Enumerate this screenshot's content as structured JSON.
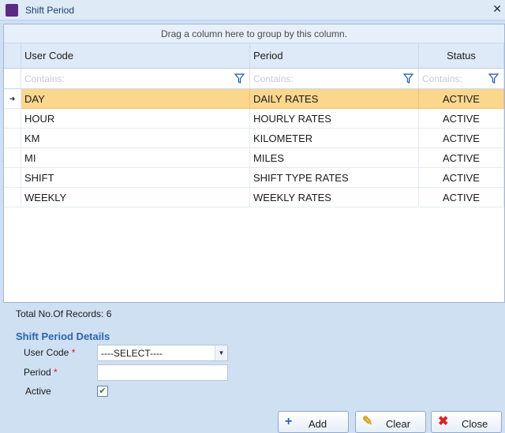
{
  "window": {
    "title": "Shift Period"
  },
  "grid": {
    "group_hint": "Drag a column here to group by this column.",
    "columns": [
      "User Code",
      "Period",
      "Status"
    ],
    "filter_placeholder": "Contains:",
    "rows": [
      {
        "code": "DAY",
        "period": "DAILY RATES",
        "status": "ACTIVE",
        "selected": true
      },
      {
        "code": "HOUR",
        "period": "HOURLY RATES",
        "status": "ACTIVE"
      },
      {
        "code": "KM",
        "period": "KILOMETER",
        "status": "ACTIVE"
      },
      {
        "code": "MI",
        "period": "MILES",
        "status": "ACTIVE"
      },
      {
        "code": "SHIFT",
        "period": "SHIFT TYPE RATES",
        "status": "ACTIVE"
      },
      {
        "code": "WEEKLY",
        "period": "WEEKLY RATES",
        "status": "ACTIVE"
      }
    ]
  },
  "footer": {
    "total_records": "Total No.Of Records: 6"
  },
  "details": {
    "title": "Shift Period  Details",
    "user_code_label": "User Code",
    "period_label": "Period",
    "active_label": "Active",
    "required_marker": "*",
    "user_code_value": "----SELECT----",
    "active_checked": true
  },
  "buttons": {
    "add": "Add",
    "clear": "Clear",
    "close": "Close"
  },
  "colors": {
    "selection": "#fbd68d",
    "section_title": "#2b63b1"
  }
}
